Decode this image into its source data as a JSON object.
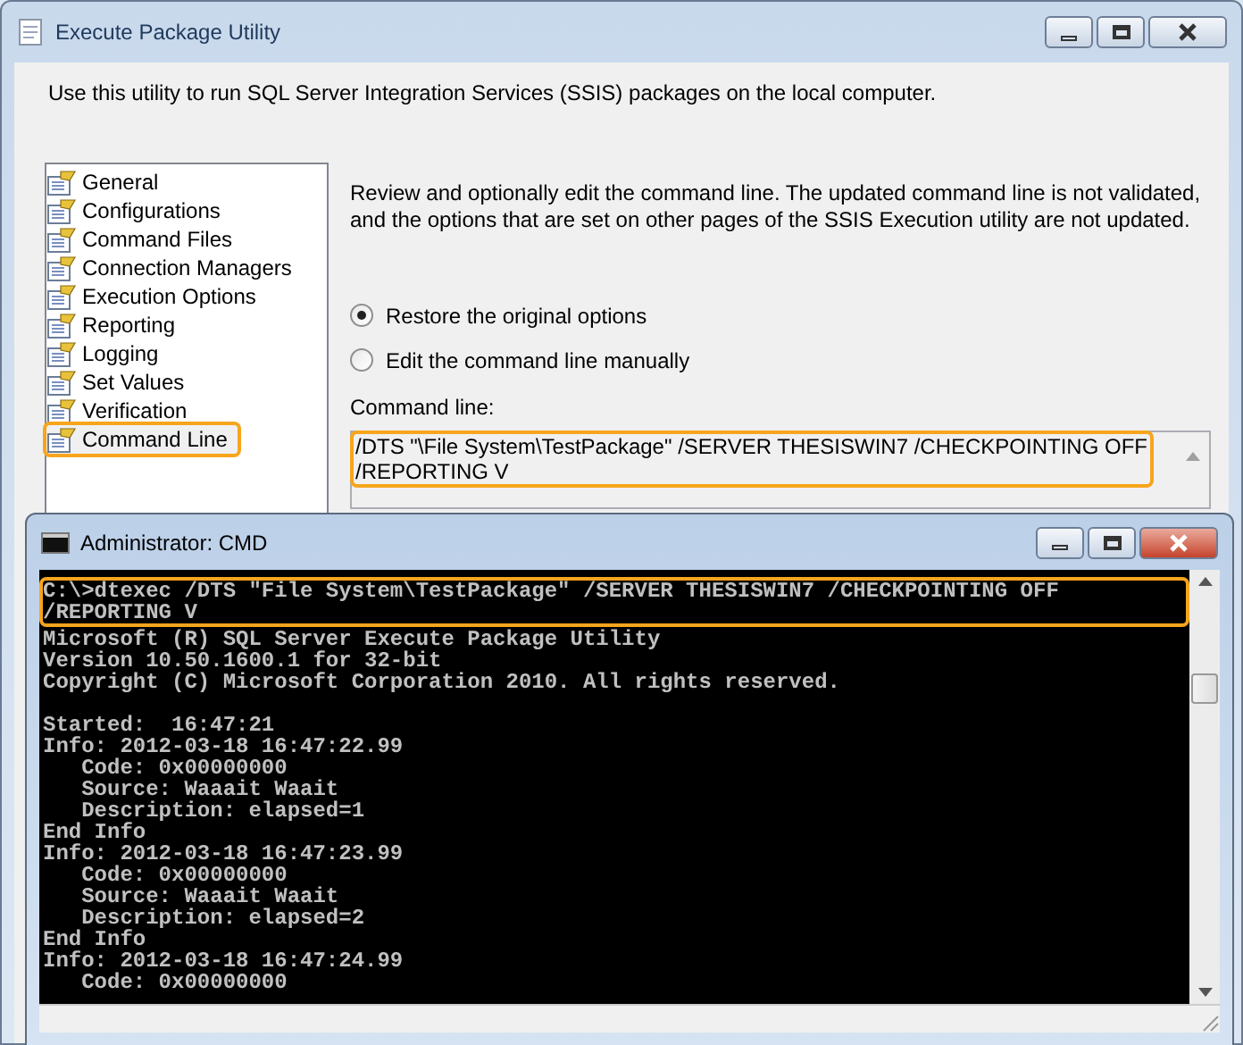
{
  "dialog": {
    "title": "Execute Package Utility",
    "intro": "Use this utility to run SQL Server Integration Services (SSIS) packages on the local computer.",
    "pages": [
      {
        "label": "General",
        "selected": false
      },
      {
        "label": "Configurations",
        "selected": false
      },
      {
        "label": "Command Files",
        "selected": false
      },
      {
        "label": "Connection Managers",
        "selected": false
      },
      {
        "label": "Execution Options",
        "selected": false
      },
      {
        "label": "Reporting",
        "selected": false
      },
      {
        "label": "Logging",
        "selected": false
      },
      {
        "label": "Set Values",
        "selected": false
      },
      {
        "label": "Verification",
        "selected": false
      },
      {
        "label": "Command Line",
        "selected": true
      }
    ],
    "description": "Review and optionally edit the command line. The updated command line is not validated, and the options that are set on other pages of the SSIS Execution utility are not updated.",
    "options": [
      {
        "label": "Restore the original options",
        "selected": true
      },
      {
        "label": "Edit the command line manually",
        "selected": false
      }
    ],
    "command_line_label": "Command line:",
    "command_line": [
      "/DTS \"\\File System\\TestPackage\" /SERVER THESISWIN7 /CHECKPOINTING OFF",
      "/REPORTING V"
    ]
  },
  "console": {
    "title": "Administrator: CMD",
    "command_lines": [
      "C:\\>dtexec /DTS \"File System\\TestPackage\" /SERVER THESISWIN7 /CHECKPOINTING OFF",
      "/REPORTING V"
    ],
    "header_lines": [
      "Microsoft (R) SQL Server Execute Package Utility",
      "Version 10.50.1600.1 for 32-bit",
      "Copyright (C) Microsoft Corporation 2010. All rights reserved."
    ],
    "log_lines": [
      "Started:  16:47:21",
      "Info: 2012-03-18 16:47:22.99",
      "   Code: 0x00000000",
      "   Source: Waaait Waait",
      "   Description: elapsed=1",
      "End Info",
      "Info: 2012-03-18 16:47:23.99",
      "   Code: 0x00000000",
      "   Source: Waaait Waait",
      "   Description: elapsed=2",
      "End Info",
      "Info: 2012-03-18 16:47:24.99",
      "   Code: 0x00000000"
    ]
  }
}
